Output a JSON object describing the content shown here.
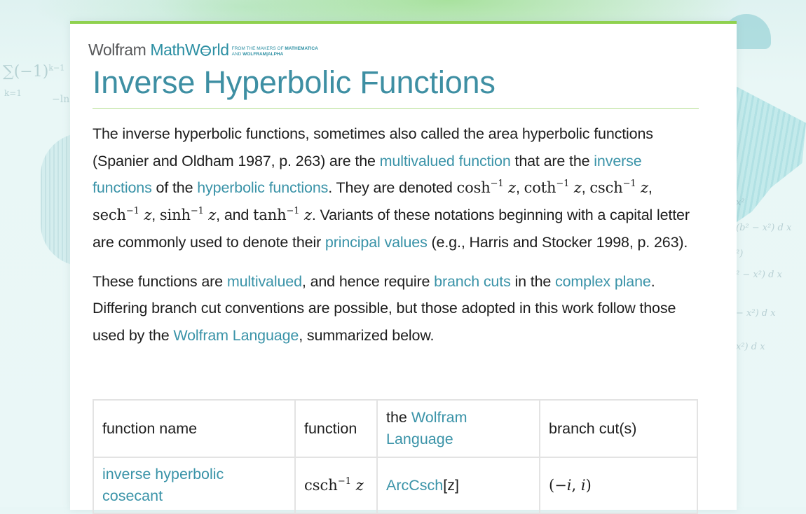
{
  "brand": {
    "wolfram": "Wolfram",
    "mathworld_a": "MathW",
    "mathworld_b": "rld",
    "tagline_1_prefix": "FROM THE MAKERS OF ",
    "tagline_1_bold": "MATHEMATICA",
    "tagline_2_prefix": "AND ",
    "tagline_2_bold": "WOLFRAM|ALPHA"
  },
  "page_title": "Inverse Hyperbolic Functions",
  "background": {
    "sum_formula": "∑(−1)",
    "sum_sup": "k−1",
    "sum_index": "k=1",
    "ln_fragment": "−ln",
    "integrand_fragments": [
      "x²",
      "(b² − x²)  d x",
      "²)",
      "² − x²)  d x",
      "− x²)  d x",
      "x²)  d x"
    ]
  },
  "colors": {
    "accent_green": "#8fd14f",
    "title_teal": "#3e8fa3",
    "link_teal": "#3a93a8"
  },
  "para1": {
    "t1": "The inverse hyperbolic functions, sometimes also called the area hyperbolic functions (Spanier and Oldham 1987, p. 263) are the ",
    "l1": "multivalued function",
    "t2": " that are the ",
    "l2": "inverse functions",
    "t3": " of the ",
    "l3": "hyperbolic functions",
    "t4": ". They are denoted ",
    "f_cosh": "cosh",
    "f_coth": "coth",
    "f_csch": "csch",
    "f_sech": "sech",
    "f_sinh": "sinh",
    "f_tanh": "tanh",
    "inv": "−1",
    "var": "z",
    "comma": ", ",
    "and": ", and ",
    "t5": ". Variants of these notations beginning with a capital letter are commonly used to denote their ",
    "l4": "principal values",
    "t6": " (e.g., Harris and Stocker 1998, p. 263)."
  },
  "para2": {
    "t1": "These functions are ",
    "l1": "multivalued",
    "t2": ", and hence require ",
    "l2": "branch cuts",
    "t3": " in the ",
    "l3": "complex plane",
    "t4": ". Differing branch cut conventions are possible, but those adopted in this work follow those used by the ",
    "l4": "Wolfram Language",
    "t5": ", summarized below."
  },
  "table": {
    "headers": {
      "name": "function name",
      "function": "function",
      "wl_prefix": "the ",
      "wl_link": "Wolfram Language",
      "cuts": "branch cut(s)"
    },
    "rows": [
      {
        "name": "inverse hyperbolic cosecant",
        "func": "csch",
        "inv": "−1",
        "var": "z",
        "wl_link": "ArcCsch",
        "wl_arg": "[z]",
        "cut_open": "(−",
        "cut_i1": "i",
        "cut_sep": ", ",
        "cut_i2": "i",
        "cut_close": ")"
      }
    ]
  }
}
